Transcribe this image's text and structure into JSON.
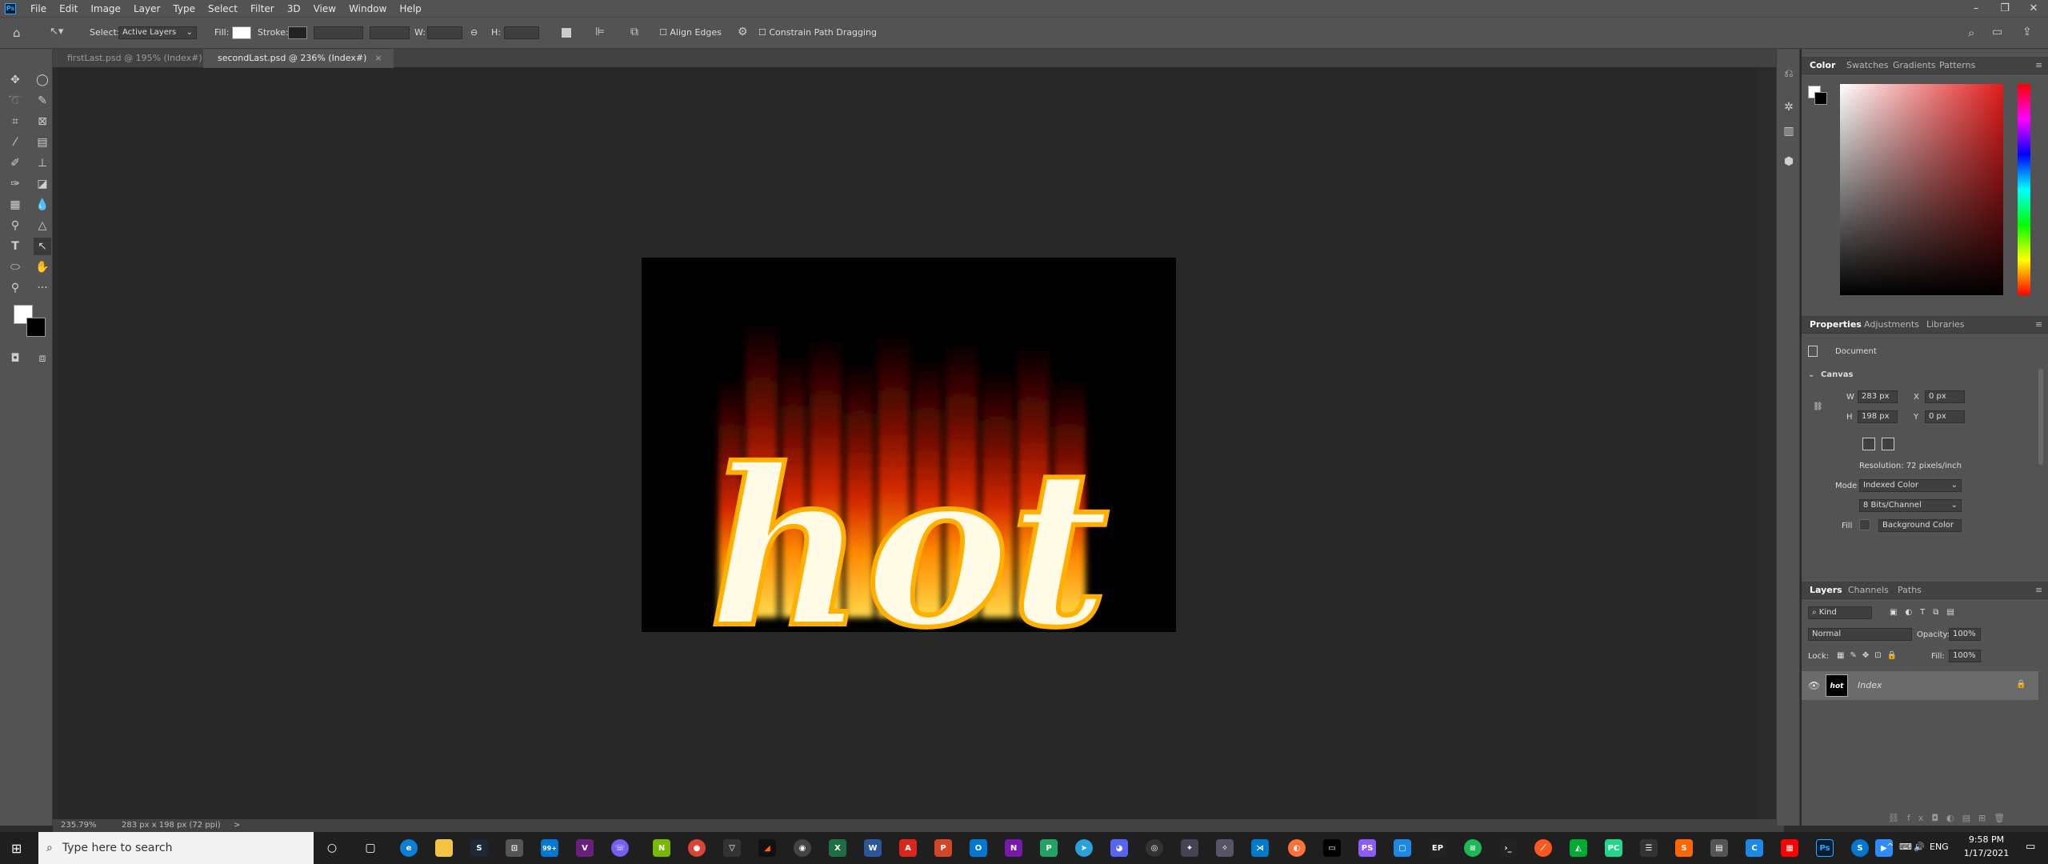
{
  "menubar": {
    "app_logo": "Ps",
    "items": [
      "File",
      "Edit",
      "Image",
      "Layer",
      "Type",
      "Select",
      "Filter",
      "3D",
      "View",
      "Window",
      "Help"
    ]
  },
  "options": {
    "select_label": "Select:",
    "select_value": "Active Layers",
    "fill_label": "Fill:",
    "stroke_label": "Stroke:",
    "w_label": "W:",
    "h_label": "H:",
    "align_edges": "Align Edges",
    "constrain": "Constrain Path Dragging"
  },
  "tabs": [
    {
      "label": "firstLast.psd @ 195% (Index#)",
      "close": "×"
    },
    {
      "label": "secondLast.psd @ 236% (Index#)",
      "close": "×"
    }
  ],
  "document": {
    "text": "hot"
  },
  "status": {
    "zoom": "235.79%",
    "info": "283 px x 198 px (72 ppi)",
    "arrow": ">"
  },
  "color_panel": {
    "tabs": [
      "Color",
      "Swatches",
      "Gradients",
      "Patterns"
    ]
  },
  "properties": {
    "tabs": [
      "Properties",
      "Adjustments",
      "Libraries"
    ],
    "doc_label": "Document",
    "section": "Canvas",
    "w_label": "W",
    "w_value": "283 px",
    "h_label": "H",
    "h_value": "198 px",
    "x_label": "X",
    "x_value": "0 px",
    "y_label": "Y",
    "y_value": "0 px",
    "resolution": "Resolution: 72 pixels/inch",
    "mode_label": "Mode",
    "mode_value": "Indexed Color",
    "bits_value": "8 Bits/Channel",
    "fill_label": "Fill",
    "fill_value": "Background Color"
  },
  "layers": {
    "tabs": [
      "Layers",
      "Channels",
      "Paths"
    ],
    "kind": "Kind",
    "blend": "Normal",
    "opacity_label": "Opacity:",
    "opacity_value": "100%",
    "lock_label": "Lock:",
    "fill_label": "Fill:",
    "fill_value": "100%",
    "layer_name": "Index",
    "thumb_text": "hot"
  },
  "taskbar": {
    "search_placeholder": "Type here to search",
    "badge": "99+",
    "lang": "ENG",
    "time": "9:58 PM",
    "date": "1/17/2021"
  }
}
